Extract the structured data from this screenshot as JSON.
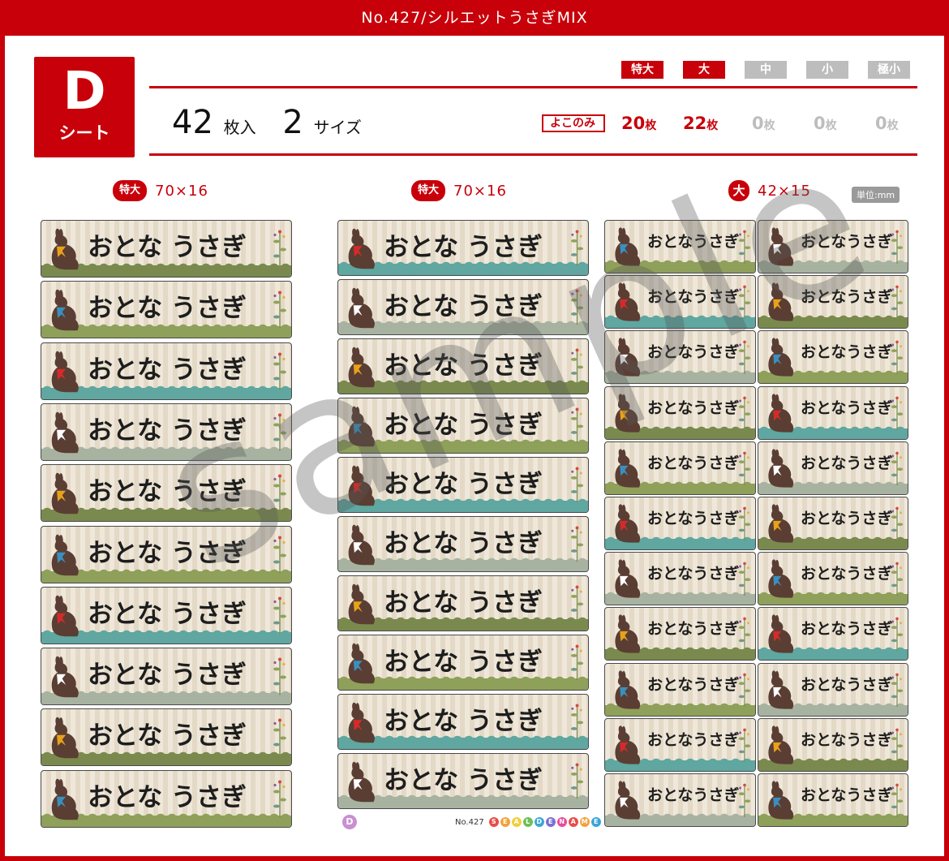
{
  "header": {
    "title": "No.427/シルエットうさぎMIX"
  },
  "sheet": {
    "letter": "D",
    "word": "シート"
  },
  "count": {
    "sheets": "42",
    "sheets_unit": "枚入",
    "sizes": "2",
    "sizes_unit": "サイズ"
  },
  "size_tabs": [
    {
      "label": "特大",
      "active": true
    },
    {
      "label": "大",
      "active": true
    },
    {
      "label": "中",
      "active": false
    },
    {
      "label": "小",
      "active": false
    },
    {
      "label": "極小",
      "active": false
    }
  ],
  "yoko_label": "よこのみ",
  "quantities": [
    {
      "num": "20",
      "unit": "枚",
      "active": true
    },
    {
      "num": "22",
      "unit": "枚",
      "active": true
    },
    {
      "num": "0",
      "unit": "枚",
      "active": false
    },
    {
      "num": "0",
      "unit": "枚",
      "active": false
    },
    {
      "num": "0",
      "unit": "枚",
      "active": false
    }
  ],
  "columns": [
    {
      "badge": "特大",
      "dims": "70×16"
    },
    {
      "badge": "特大",
      "dims": "70×16"
    },
    {
      "badge": "大",
      "dims": "42×15"
    }
  ],
  "unit_badge": "単位:mm",
  "label_name_large": "おとな うさぎ",
  "label_name_small": "おとなうさぎ",
  "watermark": "sample",
  "footer": {
    "letter": "D",
    "number": "No.427",
    "brand": "SEALDENAME"
  },
  "colors": {
    "brand_red": "#c8000a",
    "bunny": "#5a3e33",
    "ribbons": [
      "#e8a21a",
      "#3a8fc0",
      "#d62a2a",
      "#ffffff"
    ],
    "grounds": [
      "#7a8a4e",
      "#8fa05a",
      "#5fa7a0",
      "#a7b3a0"
    ]
  }
}
